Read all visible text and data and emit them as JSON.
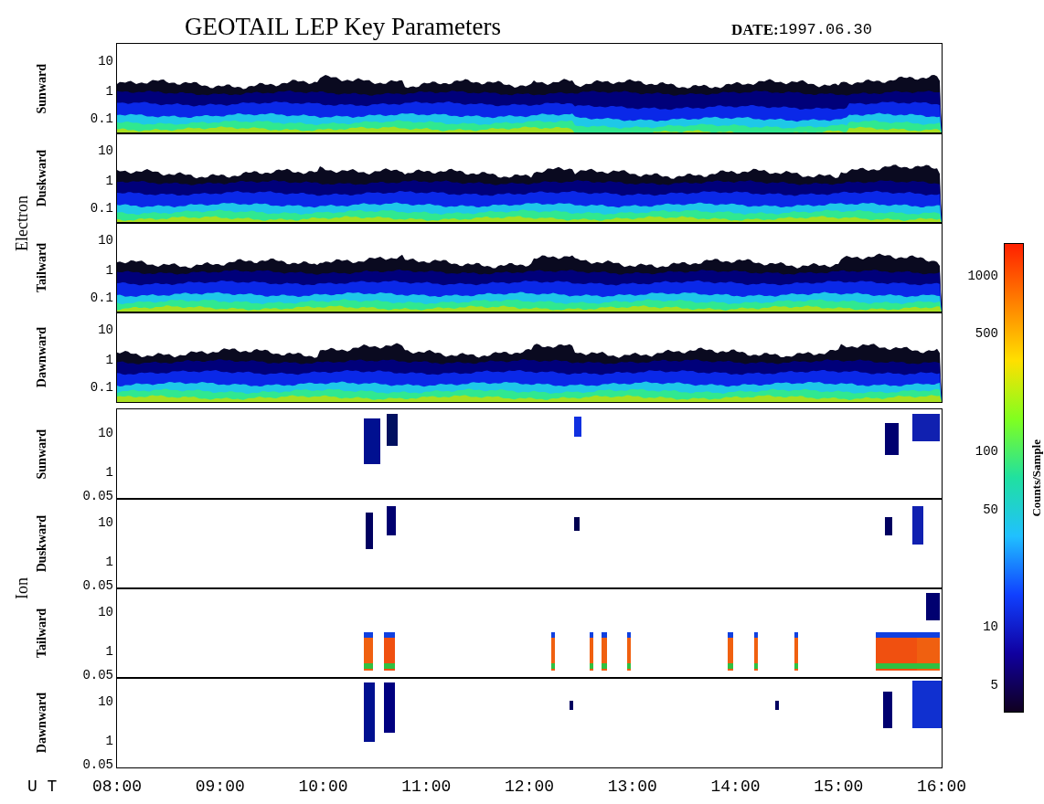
{
  "title": "GEOTAIL LEP Key Parameters",
  "date_label": "DATE:",
  "date": "1997.06.30",
  "groups": [
    {
      "name": "Electron",
      "kind": "electron",
      "panels": [
        {
          "label": "Sunward",
          "yticks": [
            "10",
            "1",
            "0.1"
          ]
        },
        {
          "label": "Duskward",
          "yticks": [
            "10",
            "1",
            "0.1"
          ]
        },
        {
          "label": "Tailward",
          "yticks": [
            "10",
            "1",
            "0.1"
          ]
        },
        {
          "label": "Dawnward",
          "yticks": [
            "10",
            "1",
            "0.1"
          ]
        }
      ]
    },
    {
      "name": "Ion",
      "kind": "ion",
      "panels": [
        {
          "label": "Sunward",
          "yticks": [
            "10",
            "1",
            "0.05"
          ]
        },
        {
          "label": "Duskward",
          "yticks": [
            "10",
            "1",
            "0.05"
          ]
        },
        {
          "label": "Tailward",
          "yticks": [
            "10",
            "1",
            "0.05"
          ]
        },
        {
          "label": "Dawnward",
          "yticks": [
            "10",
            "1",
            "0.05"
          ]
        }
      ]
    }
  ],
  "colorbar": {
    "label": "Counts/Sample",
    "ticks": [
      "1000",
      "500",
      "100",
      "50",
      "10",
      "5"
    ]
  },
  "x_axis": {
    "label": "U T",
    "ticks": [
      "08:00",
      "09:00",
      "10:00",
      "11:00",
      "12:00",
      "13:00",
      "14:00",
      "15:00",
      "16:00"
    ]
  }
}
